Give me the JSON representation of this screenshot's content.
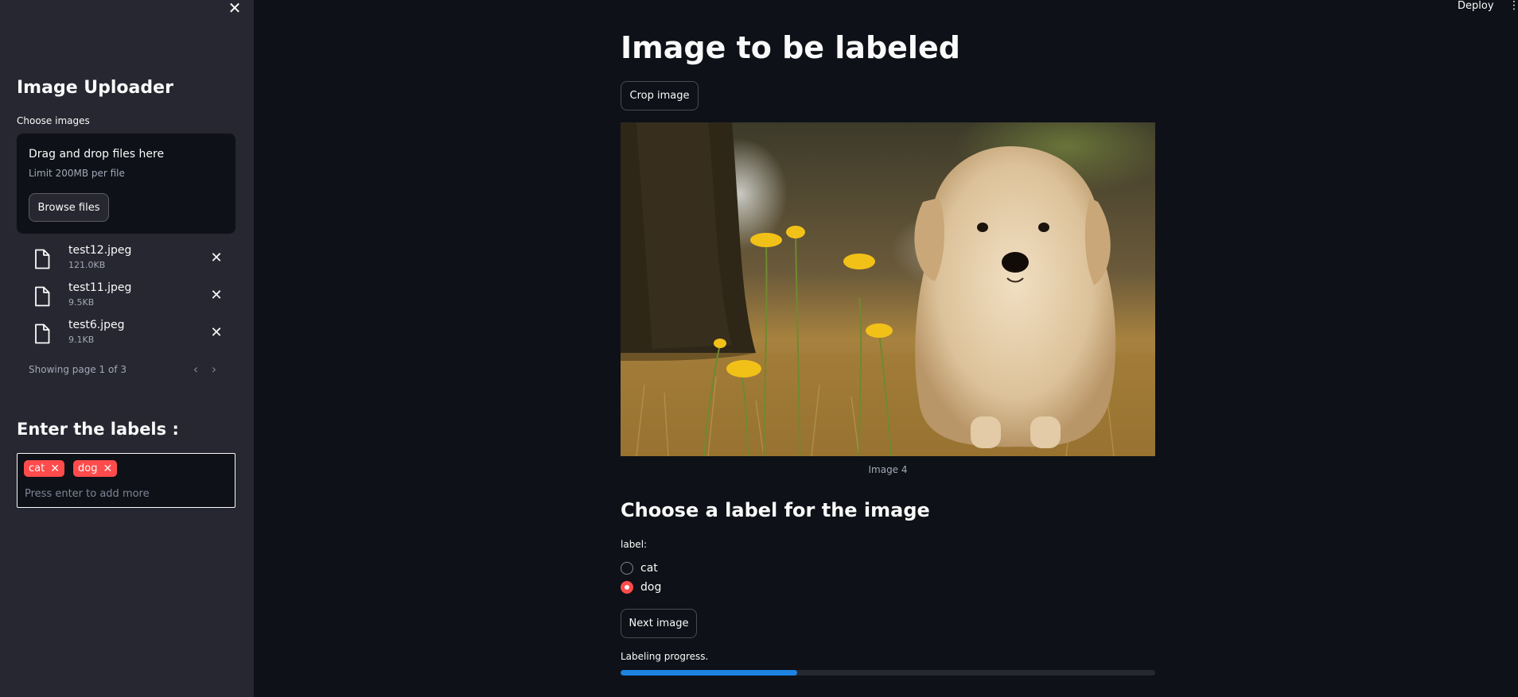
{
  "header": {
    "deploy_label": "Deploy",
    "menu_icon": "more-vertical-icon"
  },
  "sidebar": {
    "close_icon": "close-icon",
    "title": "Image Uploader",
    "uploader": {
      "label": "Choose images",
      "drop_title": "Drag and drop files here",
      "drop_limit": "Limit 200MB per file",
      "browse_label": "Browse files"
    },
    "files": [
      {
        "name": "test12.jpeg",
        "size": "121.0KB"
      },
      {
        "name": "test11.jpeg",
        "size": "9.5KB"
      },
      {
        "name": "test6.jpeg",
        "size": "9.1KB"
      }
    ],
    "pager_text": "Showing page 1 of 3",
    "labels_title": "Enter the labels :",
    "tags": [
      "cat",
      "dog"
    ],
    "tag_placeholder": "Press enter to add more"
  },
  "main": {
    "title": "Image to be labeled",
    "crop_label": "Crop image",
    "image_caption": "Image 4",
    "section_title": "Choose a label for the image",
    "radio_label": "label:",
    "options": [
      {
        "label": "cat",
        "checked": false
      },
      {
        "label": "dog",
        "checked": true
      }
    ],
    "next_label": "Next image",
    "progress_label": "Labeling progress.",
    "progress_value": 0.33
  },
  "colors": {
    "accent": "#ff4b4b",
    "progress": "#1c83e1",
    "background": "#0e1117",
    "sidebar": "#262730"
  }
}
